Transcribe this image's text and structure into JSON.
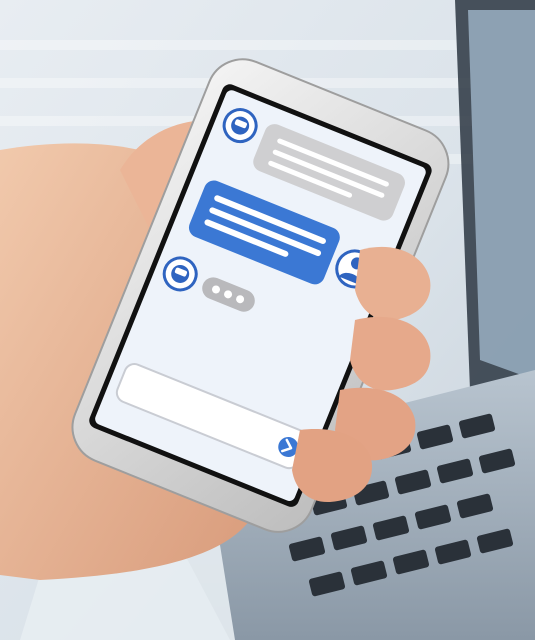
{
  "scene": {
    "description_free": true
  },
  "chat_screen": {
    "bot_avatar_1": "robot-icon",
    "bot_message_1": {
      "lines": 3
    },
    "user_message_1": {
      "lines": 3
    },
    "user_avatar": "person-icon",
    "bot_avatar_2": "robot-icon",
    "bot_typing_dots": 3,
    "input_placeholder": "",
    "send_button_icon": "chevron-right-icon"
  },
  "colors": {
    "accent_blue": "#3b78d4",
    "bubble_gray": "#cfcfd1",
    "screen_bg": "#eef3fa",
    "phone_frame": "#d8d8d8"
  }
}
